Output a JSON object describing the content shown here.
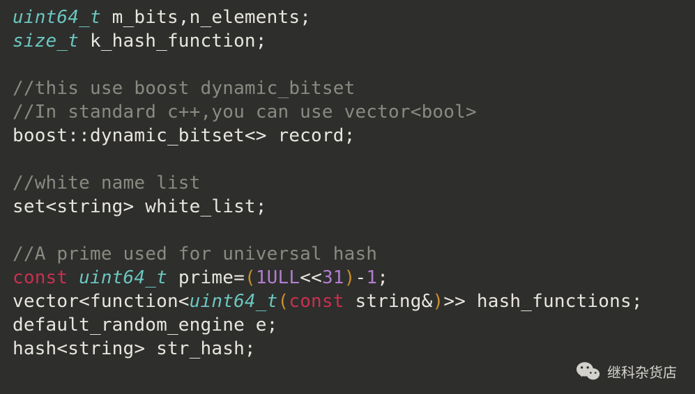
{
  "code": {
    "lines": [
      {
        "indent": "",
        "tokens": [
          {
            "cls": "tok-type",
            "t": "uint64_t"
          },
          {
            "cls": "tok-plain",
            "t": " m_bits,n_elements;"
          }
        ]
      },
      {
        "indent": "",
        "tokens": [
          {
            "cls": "tok-type",
            "t": "size_t"
          },
          {
            "cls": "tok-plain",
            "t": " k_hash_function;"
          }
        ]
      },
      {
        "indent": "",
        "tokens": []
      },
      {
        "indent": "",
        "tokens": [
          {
            "cls": "tok-comment",
            "t": "//this use boost dynamic_bitset"
          }
        ]
      },
      {
        "indent": "",
        "tokens": [
          {
            "cls": "tok-comment",
            "t": "//In standard c++,you can use vector<bool>"
          }
        ]
      },
      {
        "indent": "",
        "tokens": [
          {
            "cls": "tok-plain",
            "t": "boost::dynamic_bitset<> record;"
          }
        ]
      },
      {
        "indent": "",
        "tokens": []
      },
      {
        "indent": "",
        "tokens": [
          {
            "cls": "tok-comment",
            "t": "//white name list"
          }
        ]
      },
      {
        "indent": "",
        "tokens": [
          {
            "cls": "tok-plain",
            "t": "set<string> white_list;"
          }
        ]
      },
      {
        "indent": "",
        "tokens": []
      },
      {
        "indent": "",
        "tokens": [
          {
            "cls": "tok-comment",
            "t": "//A prime used for universal hash"
          }
        ]
      },
      {
        "indent": "",
        "tokens": [
          {
            "cls": "tok-kw",
            "t": "const"
          },
          {
            "cls": "tok-plain",
            "t": " "
          },
          {
            "cls": "tok-type",
            "t": "uint64_t"
          },
          {
            "cls": "tok-plain",
            "t": " prime="
          },
          {
            "cls": "tok-paren",
            "t": "("
          },
          {
            "cls": "tok-num",
            "t": "1ULL"
          },
          {
            "cls": "tok-plain",
            "t": "<<"
          },
          {
            "cls": "tok-num",
            "t": "31"
          },
          {
            "cls": "tok-paren",
            "t": ")"
          },
          {
            "cls": "tok-plain",
            "t": "-"
          },
          {
            "cls": "tok-num",
            "t": "1"
          },
          {
            "cls": "tok-plain",
            "t": ";"
          }
        ]
      },
      {
        "indent": "",
        "tokens": [
          {
            "cls": "tok-plain",
            "t": "vector<function<"
          },
          {
            "cls": "tok-type",
            "t": "uint64_t"
          },
          {
            "cls": "tok-paren",
            "t": "("
          },
          {
            "cls": "tok-kw",
            "t": "const"
          },
          {
            "cls": "tok-plain",
            "t": " string&"
          },
          {
            "cls": "tok-paren",
            "t": ")"
          },
          {
            "cls": "tok-plain",
            "t": ">> hash_functions;"
          }
        ]
      },
      {
        "indent": "",
        "tokens": [
          {
            "cls": "tok-plain",
            "t": "default_random_engine e;"
          }
        ]
      },
      {
        "indent": "",
        "tokens": [
          {
            "cls": "tok-plain",
            "t": "hash<string> str_hash;"
          }
        ]
      }
    ]
  },
  "watermark": {
    "text": "继科杂货店"
  }
}
